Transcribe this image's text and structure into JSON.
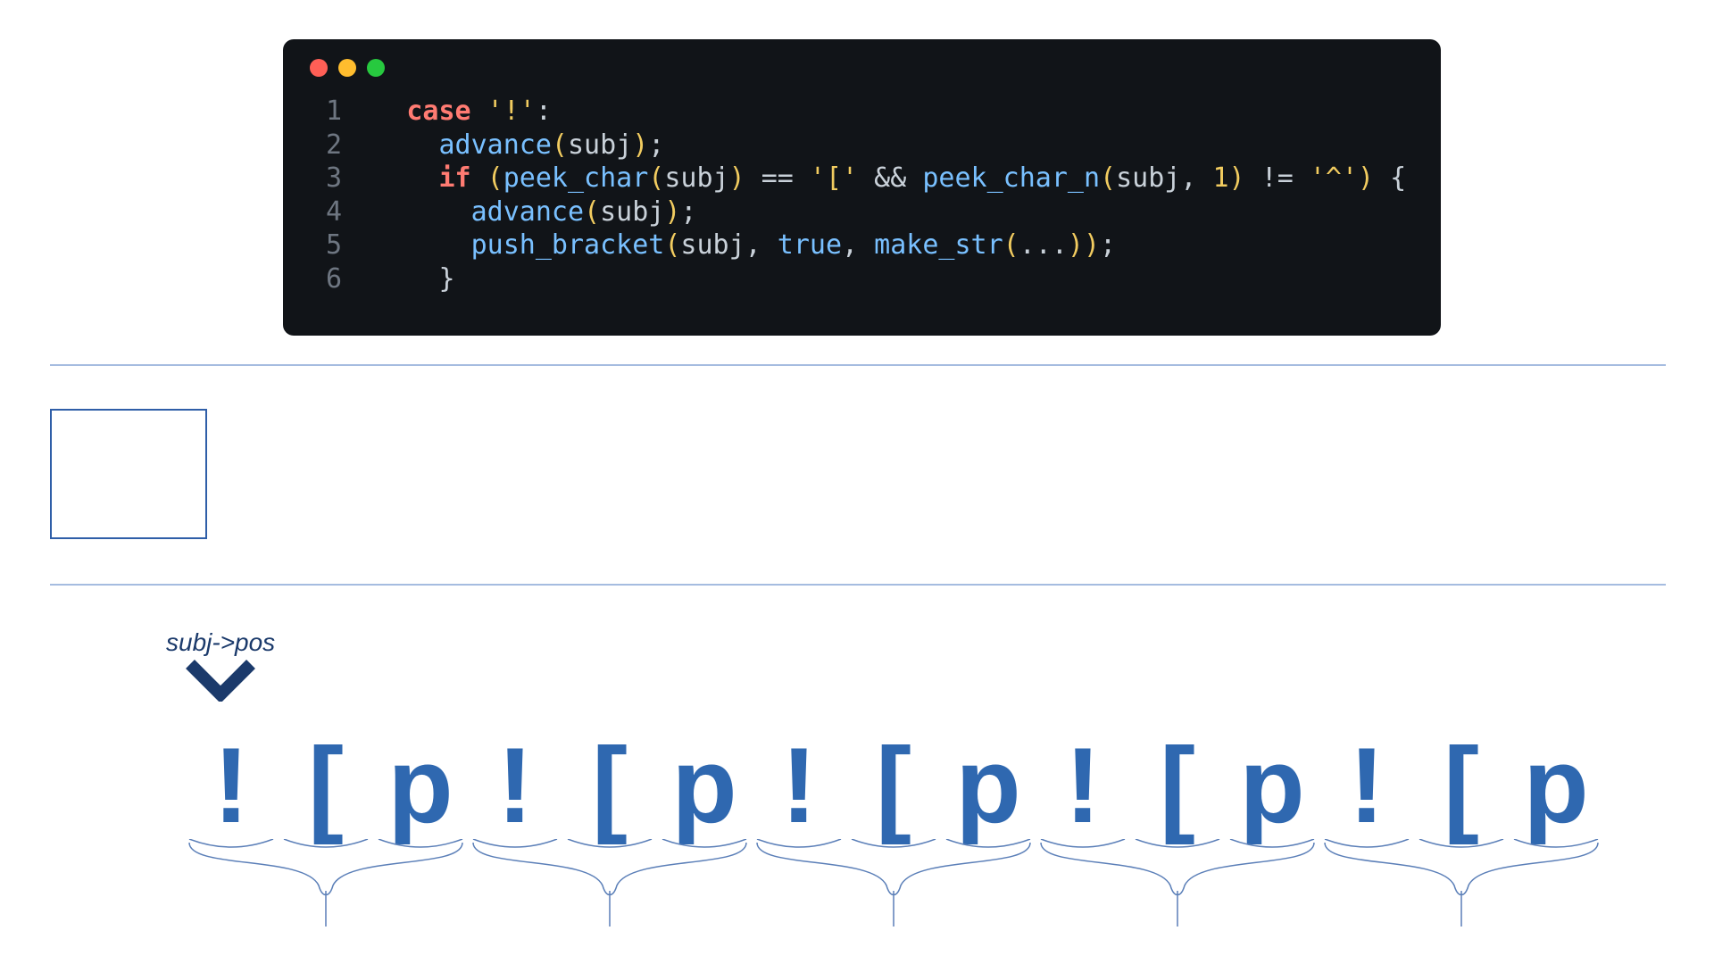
{
  "code": {
    "lines": [
      {
        "n": "1",
        "indent": "  ",
        "tokens": [
          {
            "t": "case",
            "c": "kw"
          },
          {
            "t": " ",
            "c": "pun"
          },
          {
            "t": "'!'",
            "c": "str"
          },
          {
            "t": ":",
            "c": "pun"
          }
        ]
      },
      {
        "n": "2",
        "indent": "    ",
        "tokens": [
          {
            "t": "advance",
            "c": "fn"
          },
          {
            "t": "(",
            "c": "par"
          },
          {
            "t": "subj",
            "c": "id"
          },
          {
            "t": ")",
            "c": "par"
          },
          {
            "t": ";",
            "c": "pun"
          }
        ]
      },
      {
        "n": "3",
        "indent": "    ",
        "tokens": [
          {
            "t": "if",
            "c": "kw"
          },
          {
            "t": " (",
            "c": "par"
          },
          {
            "t": "peek_char",
            "c": "fn"
          },
          {
            "t": "(",
            "c": "par"
          },
          {
            "t": "subj",
            "c": "id"
          },
          {
            "t": ")",
            "c": "par"
          },
          {
            "t": " == ",
            "c": "pun"
          },
          {
            "t": "'['",
            "c": "str"
          },
          {
            "t": " && ",
            "c": "pun"
          },
          {
            "t": "peek_char_n",
            "c": "fn"
          },
          {
            "t": "(",
            "c": "par"
          },
          {
            "t": "subj",
            "c": "id"
          },
          {
            "t": ", ",
            "c": "pun"
          },
          {
            "t": "1",
            "c": "num"
          },
          {
            "t": ")",
            "c": "par"
          },
          {
            "t": " != ",
            "c": "pun"
          },
          {
            "t": "'^'",
            "c": "str"
          },
          {
            "t": ")",
            "c": "par"
          },
          {
            "t": " {",
            "c": "pun"
          }
        ]
      },
      {
        "n": "4",
        "indent": "      ",
        "tokens": [
          {
            "t": "advance",
            "c": "fn"
          },
          {
            "t": "(",
            "c": "par"
          },
          {
            "t": "subj",
            "c": "id"
          },
          {
            "t": ")",
            "c": "par"
          },
          {
            "t": ";",
            "c": "pun"
          }
        ]
      },
      {
        "n": "5",
        "indent": "      ",
        "tokens": [
          {
            "t": "push_bracket",
            "c": "fn"
          },
          {
            "t": "(",
            "c": "par"
          },
          {
            "t": "subj",
            "c": "id"
          },
          {
            "t": ", ",
            "c": "pun"
          },
          {
            "t": "true",
            "c": "bool"
          },
          {
            "t": ", ",
            "c": "pun"
          },
          {
            "t": "make_str",
            "c": "fn"
          },
          {
            "t": "(",
            "c": "par"
          },
          {
            "t": "...",
            "c": "pun"
          },
          {
            "t": ")",
            "c": "par"
          },
          {
            "t": ")",
            "c": "par"
          },
          {
            "t": ";",
            "c": "pun"
          }
        ]
      },
      {
        "n": "6",
        "indent": "    ",
        "tokens": [
          {
            "t": "}",
            "c": "pun"
          }
        ]
      }
    ]
  },
  "pointer_label": "subj->pos",
  "input_chars": [
    "!",
    "[",
    "p",
    "!",
    "[",
    "p",
    "!",
    "[",
    "p",
    "!",
    "[",
    "p",
    "!",
    "[",
    "p"
  ],
  "colors": {
    "code_bg": "#111418",
    "blue": "#2f68b0",
    "dark_blue": "#1b3a6b",
    "rule": "#a5bce0"
  }
}
